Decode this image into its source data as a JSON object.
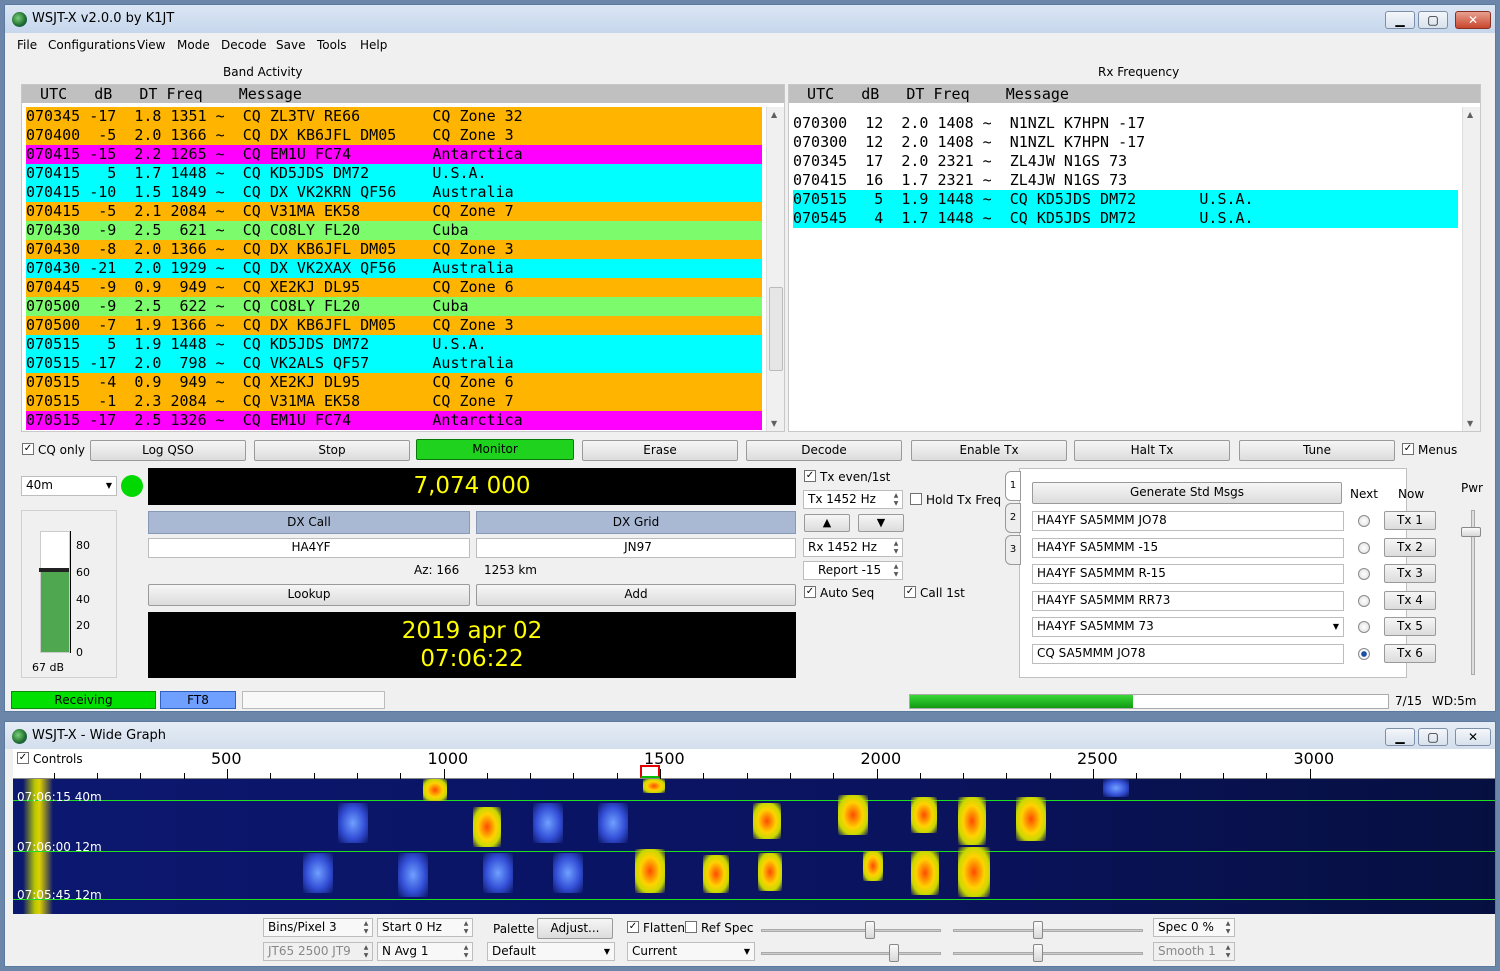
{
  "main": {
    "title": "WSJT-X   v2.0.0   by K1JT",
    "menu": [
      "File",
      "Configurations",
      "View",
      "Mode",
      "Decode",
      "Save",
      "Tools",
      "Help"
    ],
    "window_buttons": {
      "minimize": "▁",
      "maximize": "▢",
      "close": "✕"
    }
  },
  "band": {
    "label": "Band Activity",
    "header": "  UTC   dB   DT Freq    Message",
    "rows": [
      {
        "text": "070345 -17  1.8 1351 ~  CQ ZL3TV RE66        CQ Zone 32",
        "color": "#ffb400"
      },
      {
        "text": "070400  -5  2.0 1366 ~  CQ DX KB6JFL DM05    CQ Zone 3",
        "color": "#ffb400"
      },
      {
        "text": "070415 -15  2.2 1265 ~  CQ EM1U FC74         Antarctica",
        "color": "#ff00ff"
      },
      {
        "text": "070415   5  1.7 1448 ~  CQ KD5JDS DM72       U.S.A.",
        "color": "#00ffff"
      },
      {
        "text": "070415 -10  1.5 1849 ~  CQ DX VK2KRN QF56    Australia",
        "color": "#00ffff"
      },
      {
        "text": "070415  -5  2.1 2084 ~  CQ V31MA EK58        CQ Zone 7",
        "color": "#ffb400"
      },
      {
        "text": "070430  -9  2.5  621 ~  CQ CO8LY FL20        Cuba",
        "color": "#7cfc6c"
      },
      {
        "text": "070430  -8  2.0 1366 ~  CQ DX KB6JFL DM05    CQ Zone 3",
        "color": "#ffb400"
      },
      {
        "text": "070430 -21  2.0 1929 ~  CQ DX VK2XAX QF56    Australia",
        "color": "#00ffff"
      },
      {
        "text": "070445  -9  0.9  949 ~  CQ XE2KJ DL95        CQ Zone 6",
        "color": "#ffb400"
      },
      {
        "text": "070500  -9  2.5  622 ~  CQ CO8LY FL20        Cuba",
        "color": "#7cfc6c"
      },
      {
        "text": "070500  -7  1.9 1366 ~  CQ DX KB6JFL DM05    CQ Zone 3",
        "color": "#ffb400"
      },
      {
        "text": "070515   5  1.9 1448 ~  CQ KD5JDS DM72       U.S.A.",
        "color": "#00ffff"
      },
      {
        "text": "070515 -17  2.0  798 ~  CQ VK2ALS QF57       Australia",
        "color": "#00ffff"
      },
      {
        "text": "070515  -4  0.9  949 ~  CQ XE2KJ DL95        CQ Zone 6",
        "color": "#ffb400"
      },
      {
        "text": "070515  -1  2.3 2084 ~  CQ V31MA EK58        CQ Zone 7",
        "color": "#ffb400"
      },
      {
        "text": "070515 -17  2.5 1326 ~  CQ EM1U FC74         Antarctica",
        "color": "#ff00ff"
      }
    ]
  },
  "rx": {
    "label": "Rx Frequency",
    "header": "  UTC   dB   DT Freq    Message",
    "rows": [
      {
        "text": "070300  12  2.0 1408 ~  N1NZL K7HPN -17",
        "color": "#ffffff"
      },
      {
        "text": "070300  12  2.0 1408 ~  N1NZL K7HPN -17",
        "color": "#ffffff"
      },
      {
        "text": "070345  17  2.0 2321 ~  ZL4JW N1GS 73",
        "color": "#ffffff"
      },
      {
        "text": "070415  16  1.7 2321 ~  ZL4JW N1GS 73",
        "color": "#ffffff"
      },
      {
        "text": "070515   5  1.9 1448 ~  CQ KD5JDS DM72       U.S.A.",
        "color": "#00ffff"
      },
      {
        "text": "070545   4  1.7 1448 ~  CQ KD5JDS DM72       U.S.A.",
        "color": "#00ffff"
      }
    ]
  },
  "controls": {
    "cq_only": "CQ only",
    "buttons": {
      "log_qso": "Log QSO",
      "stop": "Stop",
      "monitor": "Monitor",
      "erase": "Erase",
      "decode": "Decode",
      "enable_tx": "Enable Tx",
      "halt_tx": "Halt Tx",
      "tune": "Tune"
    },
    "menus": "Menus",
    "band": "40m",
    "frequency": "7,074 000",
    "dx_call_label": "DX Call",
    "dx_grid_label": "DX Grid",
    "dx_call": "HA4YF",
    "dx_grid": "JN97",
    "az": "Az: 166",
    "distance": "1253 km",
    "lookup": "Lookup",
    "add": "Add",
    "date": "2019 apr 02",
    "time": "07:06:22",
    "meter_ticks": [
      "80",
      "60",
      "40",
      "20",
      "0"
    ],
    "meter_db": "67 dB",
    "meter_level": 0.67,
    "tx_even": "Tx even/1st",
    "tx_freq": "Tx  1452  Hz",
    "hold_tx": "Hold Tx Freq",
    "up": "▲",
    "down": "▼",
    "rx_freq": "Rx  1452  Hz",
    "report": "Report -15",
    "auto_seq": "Auto Seq",
    "call_1st": "Call 1st",
    "tabs": [
      "1",
      "2",
      "3"
    ],
    "generate": "Generate Std Msgs",
    "next": "Next",
    "now": "Now",
    "pwr": "Pwr",
    "messages": [
      "HA4YF SA5MMM JO78",
      "HA4YF SA5MMM -15",
      "HA4YF SA5MMM R-15",
      "HA4YF SA5MMM RR73",
      "HA4YF SA5MMM 73",
      "CQ SA5MMM JO78"
    ],
    "tx_buttons": [
      "Tx 1",
      "Tx 2",
      "Tx 3",
      "Tx 4",
      "Tx 5",
      "Tx 6"
    ],
    "status_receiving": "Receiving",
    "status_mode": "FT8",
    "progress": "7/15",
    "progress_fraction": 0.467,
    "wd": "WD:5m"
  },
  "wide": {
    "title": "WSJT-X - Wide Graph",
    "controls_chk": "Controls",
    "ticks": [
      "500",
      "1000",
      "1500",
      "2000",
      "2500",
      "3000"
    ],
    "stamps": [
      "07:06:15   40m",
      "07:06:00   12m",
      "07:05:45   12m"
    ],
    "bins": "Bins/Pixel  3",
    "start": "Start 0 Hz",
    "palette": "Palette",
    "adjust": "Adjust...",
    "flatten": "Flatten",
    "ref_spec": "Ref Spec",
    "spec": "Spec 0 %",
    "jt": "JT65  2500  JT9",
    "navg": "N Avg 1",
    "default": "Default",
    "current": "Current",
    "smooth": "Smooth   1"
  },
  "colors": {
    "monitor": "#1ed21e",
    "receiving": "#00e000",
    "ft8": "#6fa0ff",
    "green_light": "#00d800"
  }
}
